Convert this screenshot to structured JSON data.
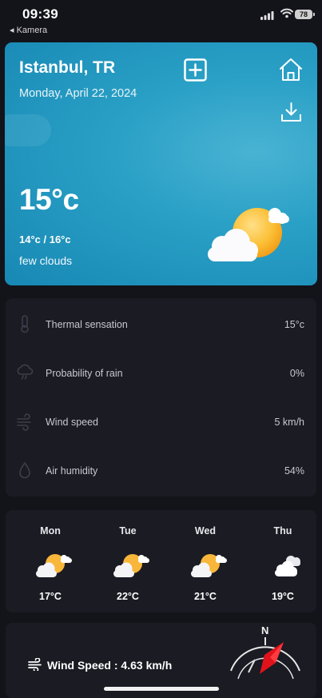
{
  "status_bar": {
    "time": "09:39",
    "back_app": "◂ Kamera",
    "battery": "78"
  },
  "header": {
    "city": "Istanbul, TR",
    "date": "Monday, April 22, 2024"
  },
  "current": {
    "temperature": "15°c",
    "range": "14°c / 16°c",
    "description": "few clouds"
  },
  "details": [
    {
      "label": "Thermal sensation",
      "value": "15°c",
      "icon": "thermometer-icon"
    },
    {
      "label": "Probability of rain",
      "value": "0%",
      "icon": "rain-cloud-icon"
    },
    {
      "label": "Wind speed",
      "value": "5 km/h",
      "icon": "wind-icon"
    },
    {
      "label": "Air humidity",
      "value": "54%",
      "icon": "droplet-icon"
    }
  ],
  "forecast": [
    {
      "day": "Mon",
      "temp": "17°C",
      "icon": "partly-sunny-icon"
    },
    {
      "day": "Tue",
      "temp": "22°C",
      "icon": "partly-sunny-icon"
    },
    {
      "day": "Wed",
      "temp": "21°C",
      "icon": "partly-sunny-icon"
    },
    {
      "day": "Thu",
      "temp": "19°C",
      "icon": "clouds-icon"
    }
  ],
  "wind_card": {
    "label": "Wind Speed : 4.63 km/h",
    "compass_north": "N"
  },
  "colors": {
    "background": "#13131a",
    "card": "#1a1b23",
    "hero": "#2aa0c6",
    "sun": "#f7b52a",
    "compass_needle": "#e0121b"
  }
}
